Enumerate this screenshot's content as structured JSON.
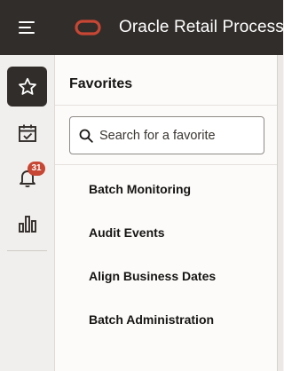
{
  "header": {
    "title": "Oracle Retail Process",
    "menu_icon": "hamburger-menu-icon",
    "logo_icon": "oracle-logo",
    "logo_color": "#c74634",
    "background": "#312d2a"
  },
  "rail": {
    "items": [
      {
        "name": "favorites",
        "icon": "star-icon",
        "active": true
      },
      {
        "name": "tasks",
        "icon": "calendar-check-icon",
        "active": false
      },
      {
        "name": "notifications",
        "icon": "bell-icon",
        "active": false,
        "badge": "31"
      },
      {
        "name": "reports",
        "icon": "bar-chart-icon",
        "active": false
      }
    ],
    "badge_color": "#c74634"
  },
  "favorites": {
    "title": "Favorites",
    "search": {
      "placeholder": "Search for a favorite",
      "value": ""
    },
    "items": [
      {
        "label": "Batch Monitoring"
      },
      {
        "label": "Audit Events"
      },
      {
        "label": "Align Business Dates"
      },
      {
        "label": "Batch Administration"
      }
    ]
  }
}
